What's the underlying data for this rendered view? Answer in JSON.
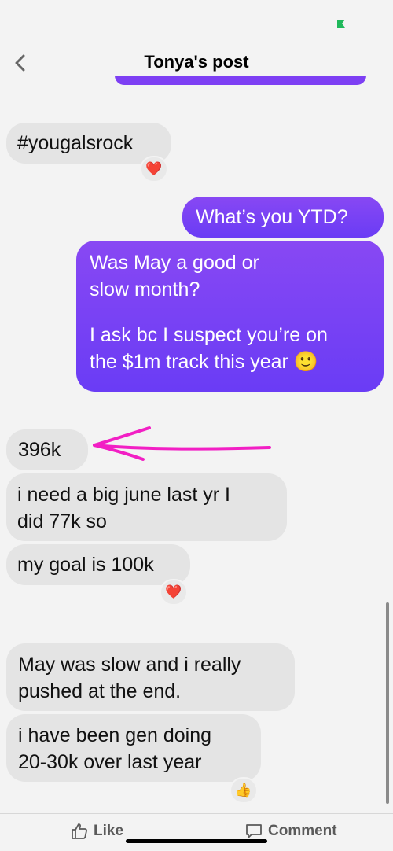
{
  "header": {
    "title": "Tonya's post"
  },
  "colors": {
    "outgoing_bubble": "#7d3ff3",
    "incoming_bubble": "#e4e4e4",
    "annotation": "#f21fc4",
    "status_indicator": "#1fb85a"
  },
  "messages": {
    "m1": "#yougalsrock",
    "m2": "What’s you YTD?",
    "m3_line1": "Was May a good or",
    "m3_line2": "slow month?",
    "m3_line3": "I ask bc I suspect you’re on",
    "m3_line4": "the $1m track this year 🙂",
    "m4": "396k",
    "m5_line1": "i need a big june  last yr I",
    "m5_line2": "did 77k  so",
    "m6": "my goal is 100k",
    "m7_line1": "May was slow and i really",
    "m7_line2": "pushed at the end.",
    "m8_line1": "i have been gen doing",
    "m8_line2": "20-30k over last year"
  },
  "reactions": {
    "r1": "❤️",
    "r2": "❤️",
    "r3": "👍"
  },
  "icons": {
    "back": "chevron-left-icon",
    "like": "thumbs-up-icon",
    "comment": "speech-bubble-icon"
  },
  "footer": {
    "like_label": "Like",
    "comment_label": "Comment"
  }
}
